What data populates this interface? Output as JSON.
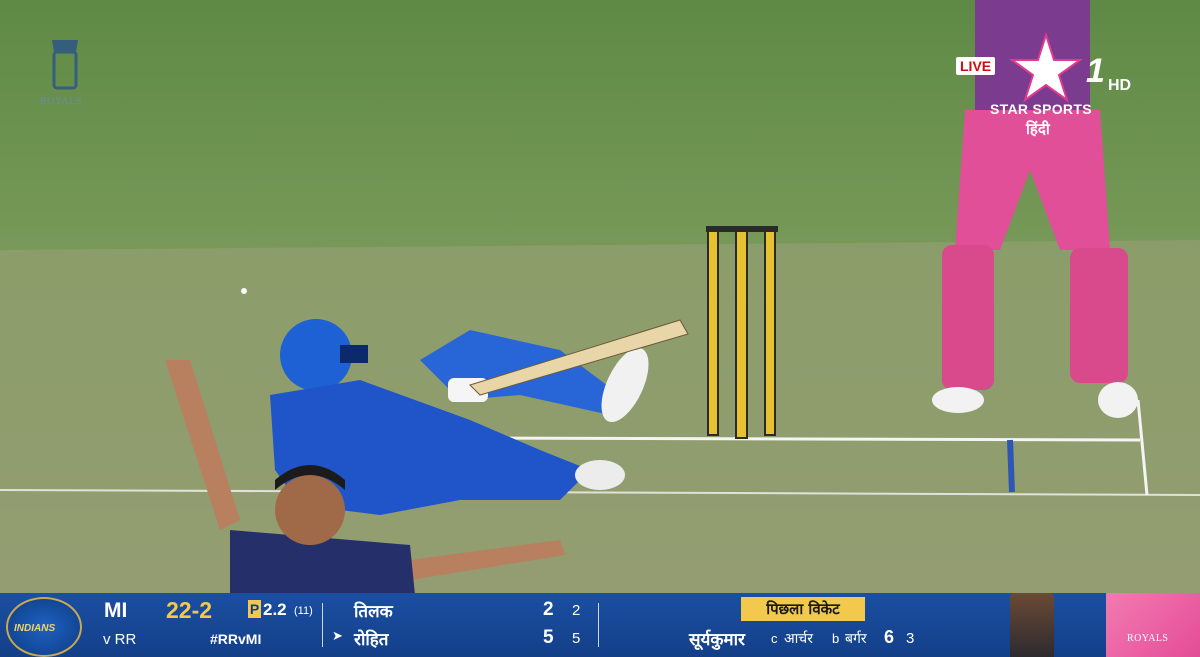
{
  "broadcast": {
    "live_label": "LIVE",
    "channel_number": "1",
    "channel_quality": "HD",
    "network": "STAR SPORTS",
    "language": "हिंदी",
    "team_watermark": "ROYALS"
  },
  "scoreboard": {
    "batting_team": "MI",
    "bowling_team_label": "v RR",
    "score": "22-2",
    "powerplay_badge": "P",
    "overs": "2.2",
    "overs_balls_note": "(11)",
    "hashtag": "#RRvMI",
    "batters": [
      {
        "name": "तिलक",
        "runs": "2",
        "balls": "2",
        "on_strike": false
      },
      {
        "name": "रोहित",
        "runs": "5",
        "balls": "5",
        "on_strike": true
      }
    ],
    "strike_marker": "➤",
    "last_wicket": {
      "title": "पिछला विकेट",
      "batter": "सूर्यकुमार",
      "caught_label": "c",
      "fielder": "आर्चर",
      "bowled_label": "b",
      "bowler": "बर्गर",
      "runs": "6",
      "balls": "3"
    },
    "mi_logo_text": "INDIANS",
    "rr_logo_text": "ROYALS"
  },
  "colors": {
    "scorebar": "#1b4fa3",
    "accent_yellow": "#f2c94c",
    "rr_pink": "#e44c97",
    "pitch_grass": "#6d8f4f"
  }
}
